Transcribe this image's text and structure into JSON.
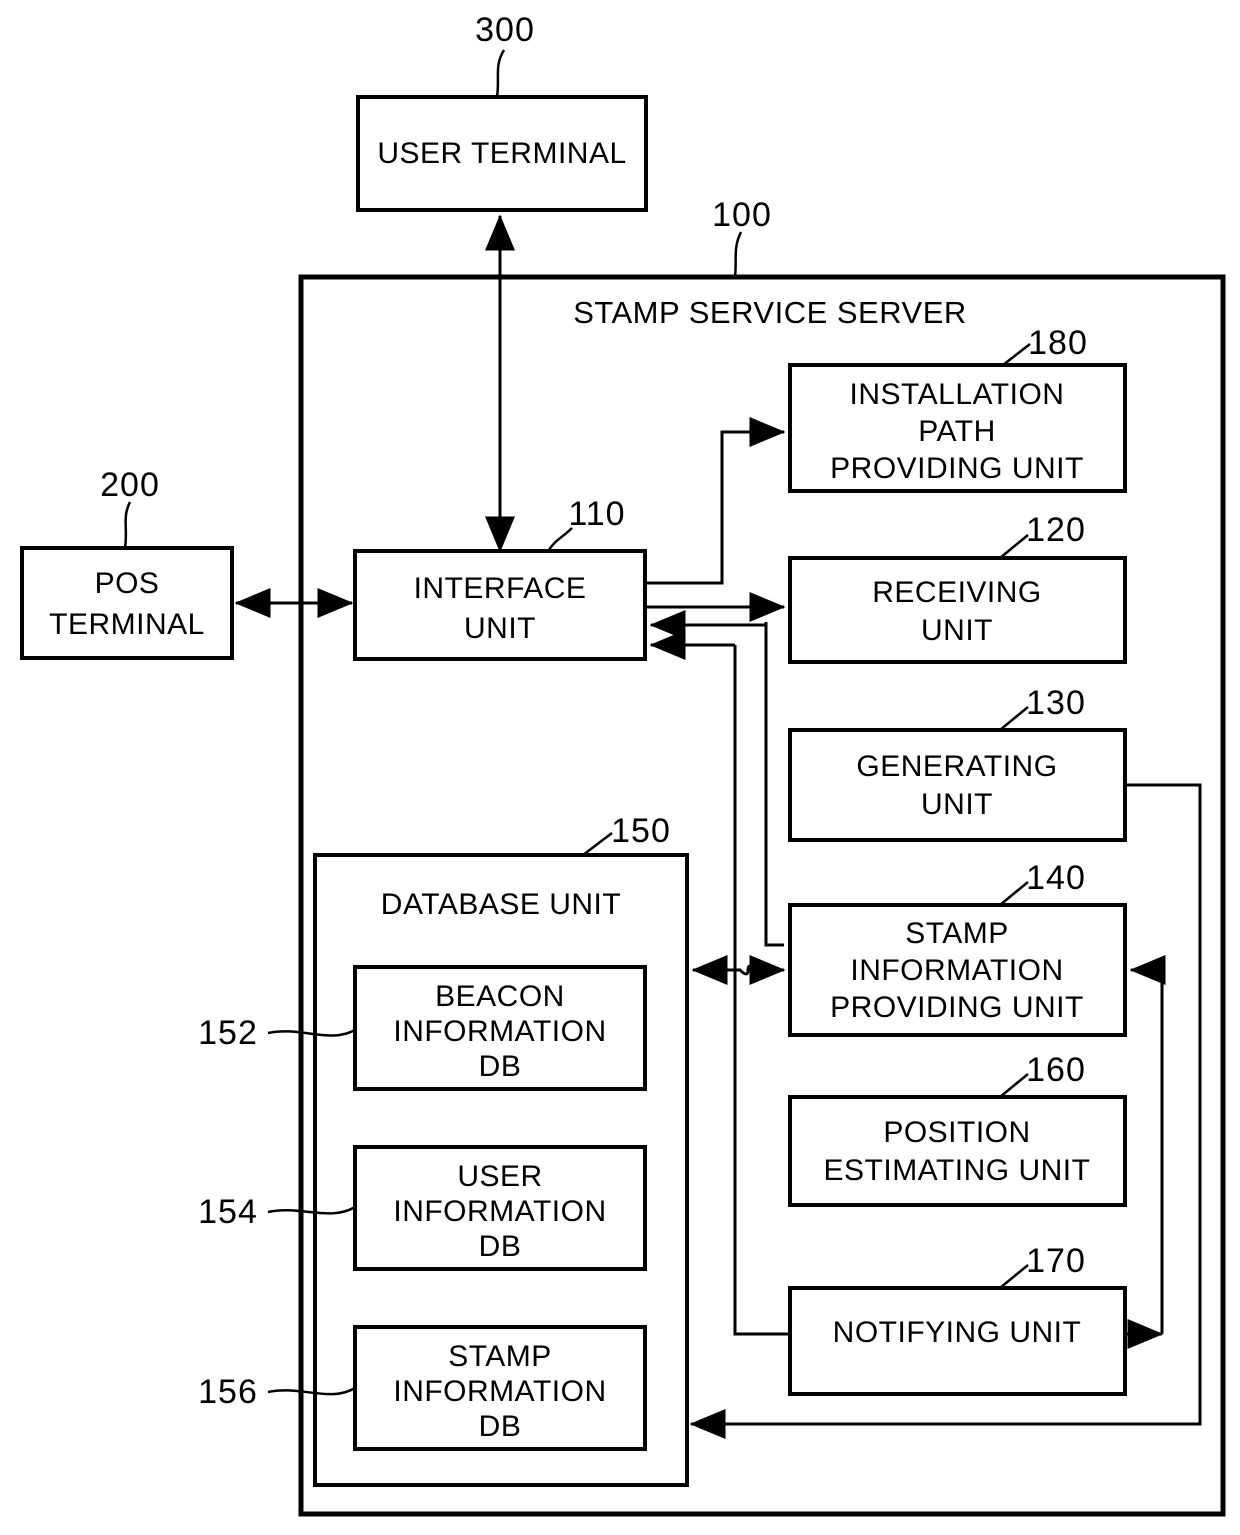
{
  "figure": {
    "type": "patent-block-diagram",
    "title": "Stamp service server block diagram"
  },
  "nodes": {
    "user_terminal": {
      "ref": "300",
      "lines": [
        "USER TERMINAL"
      ]
    },
    "pos_terminal": {
      "ref": "200",
      "lines": [
        "POS",
        "TERMINAL"
      ]
    },
    "server": {
      "ref": "100",
      "lines": [
        "STAMP SERVICE SERVER"
      ]
    },
    "interface_unit": {
      "ref": "110",
      "lines": [
        "INTERFACE",
        "UNIT"
      ]
    },
    "receiving_unit": {
      "ref": "120",
      "lines": [
        "RECEIVING",
        "UNIT"
      ]
    },
    "generating_unit": {
      "ref": "130",
      "lines": [
        "GENERATING",
        "UNIT"
      ]
    },
    "stamp_info_unit": {
      "ref": "140",
      "lines": [
        "STAMP",
        "INFORMATION",
        "PROVIDING UNIT"
      ]
    },
    "database_unit": {
      "ref": "150",
      "lines": [
        "DATABASE UNIT"
      ]
    },
    "beacon_db": {
      "ref": "152",
      "lines": [
        "BEACON",
        "INFORMATION",
        "DB"
      ]
    },
    "user_db": {
      "ref": "154",
      "lines": [
        "USER",
        "INFORMATION",
        "DB"
      ]
    },
    "stamp_db": {
      "ref": "156",
      "lines": [
        "STAMP",
        "INFORMATION",
        "DB"
      ]
    },
    "position_unit": {
      "ref": "160",
      "lines": [
        "POSITION",
        "ESTIMATING UNIT"
      ]
    },
    "notifying_unit": {
      "ref": "170",
      "lines": [
        "NOTIFYING UNIT"
      ]
    },
    "install_path_unit": {
      "ref": "180",
      "lines": [
        "INSTALLATION",
        "PATH",
        "PROVIDING UNIT"
      ]
    }
  },
  "colors": {
    "stroke": "#000000",
    "fill": "#ffffff"
  }
}
